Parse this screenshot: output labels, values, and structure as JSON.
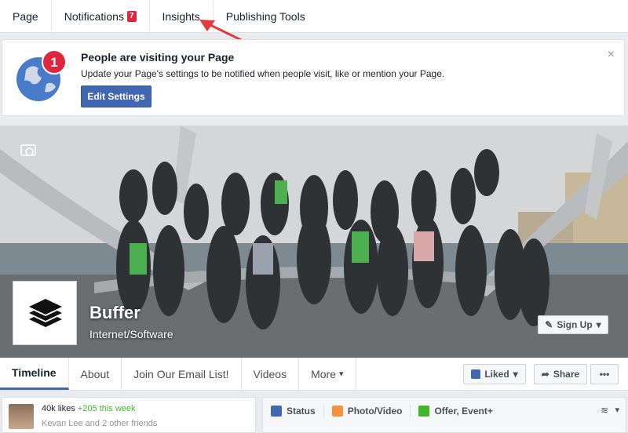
{
  "admin_bar": {
    "tabs": [
      "Page",
      "Notifications",
      "Insights",
      "Publishing Tools"
    ],
    "notifications_count": "7"
  },
  "notice": {
    "badge_count": "1",
    "title": "People are visiting your Page",
    "text": "Update your Page's settings to be notified when people visit, like or mention your Page.",
    "button": "Edit Settings",
    "close": "×"
  },
  "page": {
    "name": "Buffer",
    "category": "Internet/Software",
    "signup_button": "Sign Up"
  },
  "page_nav": {
    "tabs": [
      "Timeline",
      "About",
      "Join Our Email List!",
      "Videos",
      "More"
    ],
    "liked_button": "Liked",
    "share_button": "Share",
    "more_button": "•••"
  },
  "likes": {
    "count": "40k likes",
    "weekly": "+205 this week",
    "friends": "Kevan Lee and 2 other friends"
  },
  "composer": {
    "tabs": [
      "Status",
      "Photo/Video",
      "Offer, Event+"
    ]
  },
  "colors": {
    "brand_blue": "#4267b2",
    "badge_red": "#e0263f",
    "growth_green": "#42b72a",
    "annotation_arrow": "#e33b3b"
  }
}
